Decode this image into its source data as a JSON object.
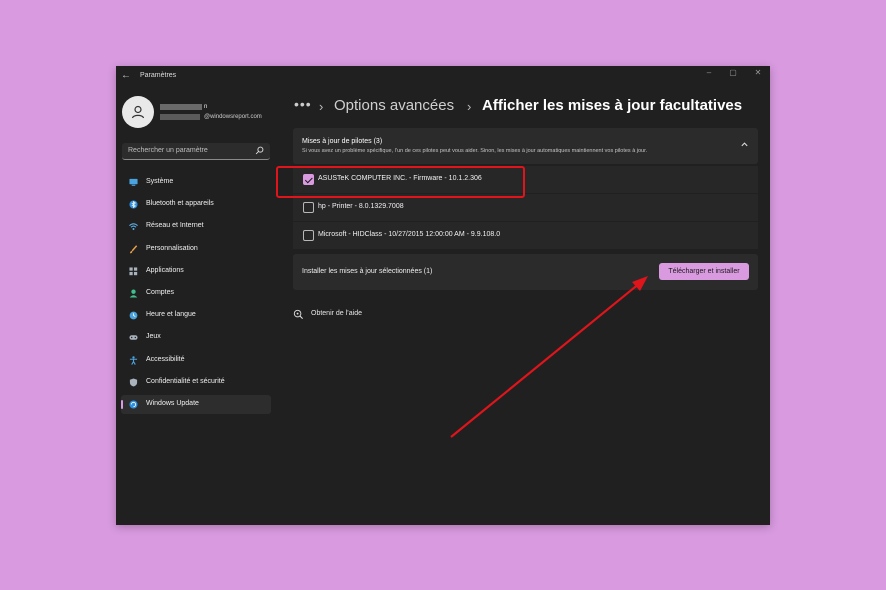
{
  "window": {
    "title": "Paramètres",
    "controls": [
      "minimize",
      "maximize",
      "close"
    ],
    "background": "#202020",
    "accent": "#d99ae0"
  },
  "user": {
    "name_visible": "n",
    "email_visible": "@windowsreport.com"
  },
  "search": {
    "placeholder": "Rechercher un paramètre"
  },
  "sidebar": {
    "items": [
      {
        "label": "Système",
        "icon": "system-monitor-icon",
        "color": "#4aa3df"
      },
      {
        "label": "Bluetooth et appareils",
        "icon": "bluetooth-icon",
        "color": "#2f8fe0"
      },
      {
        "label": "Réseau et Internet",
        "icon": "wifi-icon",
        "color": "#5ab0e8"
      },
      {
        "label": "Personnalisation",
        "icon": "brush-icon",
        "color": "#e8a04a"
      },
      {
        "label": "Applications",
        "icon": "apps-icon",
        "color": "#a9b3bd"
      },
      {
        "label": "Comptes",
        "icon": "person-icon",
        "color": "#3fbf8f"
      },
      {
        "label": "Heure et langue",
        "icon": "globe-clock-icon",
        "color": "#4aa3df"
      },
      {
        "label": "Jeux",
        "icon": "gamepad-icon",
        "color": "#a9b3bd"
      },
      {
        "label": "Accessibilité",
        "icon": "accessibility-icon",
        "color": "#4aa3df"
      },
      {
        "label": "Confidentialité et sécurité",
        "icon": "shield-icon",
        "color": "#a9b3bd"
      },
      {
        "label": "Windows Update",
        "icon": "windows-update-icon",
        "color": "#2f8fe0",
        "selected": true
      }
    ]
  },
  "breadcrumb": {
    "overflow": "•••",
    "parent": "Options avancées",
    "separator": "›",
    "current": "Afficher les mises à jour facultatives"
  },
  "drivers_section": {
    "title": "Mises à jour de pilotes (3)",
    "description": "Si vous avez un problème spécifique, l’un de ces pilotes peut vous aider. Sinon, les mises à jour automatiques maintiennent vos pilotes à jour.",
    "items": [
      {
        "label": "ASUSTeK COMPUTER INC. - Firmware - 10.1.2.306",
        "checked": true
      },
      {
        "label": "hp - Printer - 8.0.1329.7008",
        "checked": false
      },
      {
        "label": "Microsoft - HIDClass - 10/27/2015 12:00:00 AM - 9.9.108.0",
        "checked": false
      }
    ]
  },
  "install": {
    "label": "Installer les mises à jour sélectionnées (1)",
    "button": "Télécharger et installer"
  },
  "help": {
    "label": "Obtenir de l’aide"
  },
  "annotation_color": "#e0141b"
}
